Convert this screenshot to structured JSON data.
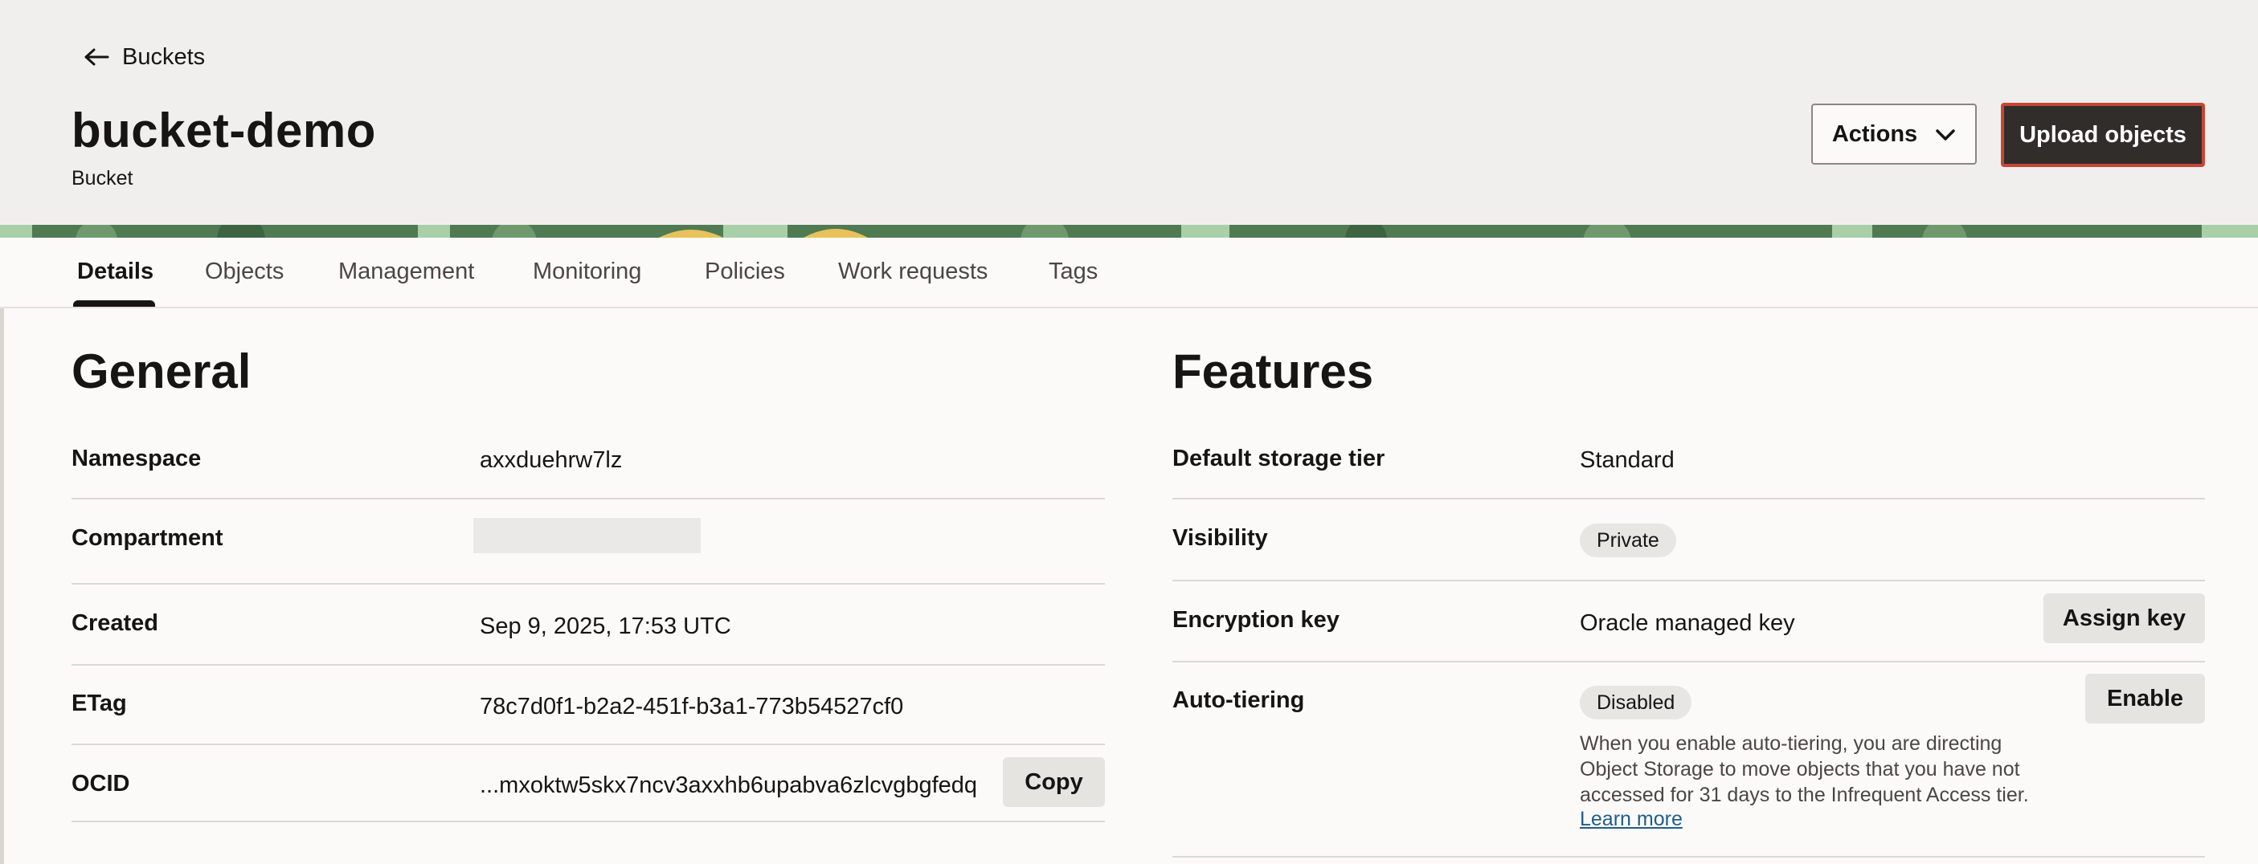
{
  "header": {
    "back_label": "Buckets",
    "title": "bucket-demo",
    "subtitle": "Bucket",
    "actions_label": "Actions",
    "upload_label": "Upload objects"
  },
  "tabs": [
    {
      "label": "Details",
      "active": true
    },
    {
      "label": "Objects"
    },
    {
      "label": "Management"
    },
    {
      "label": "Monitoring"
    },
    {
      "label": "Policies"
    },
    {
      "label": "Work requests"
    },
    {
      "label": "Tags"
    }
  ],
  "general": {
    "title": "General",
    "namespace_label": "Namespace",
    "namespace_value": "axxduehrw7lz",
    "compartment_label": "Compartment",
    "created_label": "Created",
    "created_value": "Sep 9, 2025, 17:53 UTC",
    "etag_label": "ETag",
    "etag_value": "78c7d0f1-b2a2-451f-b3a1-773b54527cf0",
    "ocid_label": "OCID",
    "ocid_value": "...mxoktw5skx7ncv3axxhb6upabva6zlcvgbgfedq",
    "copy_label": "Copy"
  },
  "features": {
    "title": "Features",
    "storage_tier_label": "Default storage tier",
    "storage_tier_value": "Standard",
    "visibility_label": "Visibility",
    "visibility_value": "Private",
    "encryption_label": "Encryption key",
    "encryption_value": "Oracle managed key",
    "assign_key_label": "Assign key",
    "autotiering_label": "Auto-tiering",
    "autotiering_value": "Disabled",
    "enable_label": "Enable",
    "autotiering_help": [
      "When you enable auto-tiering, you are directing",
      "Object Storage to move objects that you have not",
      "accessed for 31 days to the Infrequent Access tier."
    ],
    "learn_more": "Learn more"
  },
  "colors": {
    "header_bg": "#f1efed",
    "primary_button": "#312d2a",
    "primary_button_border": "#c74634",
    "banner_green": "#4f7a52",
    "link": "#1f5d8c"
  },
  "icons": [
    "arrow-left-icon",
    "chevron-down-icon"
  ]
}
